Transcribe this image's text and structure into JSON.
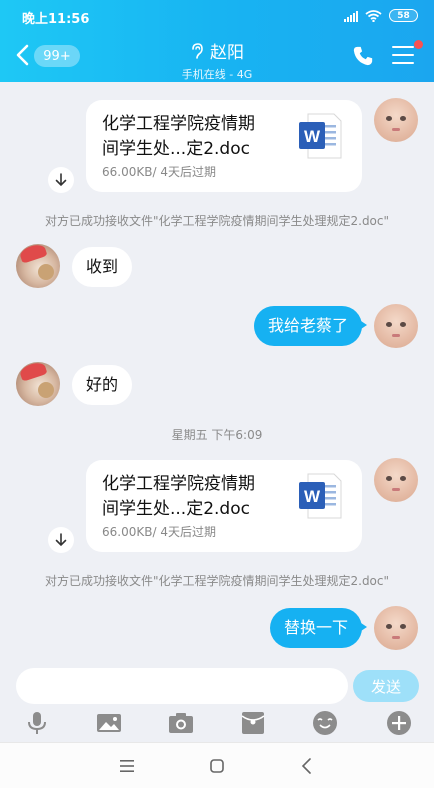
{
  "status_bar": {
    "time": "晚上11:56",
    "battery": "58"
  },
  "header": {
    "unread_badge": "99+",
    "contact_name": "赵阳",
    "contact_status": "手机在线 - 4G"
  },
  "messages": {
    "file1": {
      "name": "化学工程学院疫情期间学生处...定2.doc",
      "name_line1": "化学工程学院疫情期",
      "name_line2": "间学生处...定2.doc",
      "size": "66.00KB/",
      "expiry": "4天后过期"
    },
    "system1": "对方已成功接收文件\"化学工程学院疫情期间学生处理规定2.doc\"",
    "received1": "收到",
    "sent1": "我给老蔡了",
    "received2": "好的",
    "timestamp": "星期五 下午6:09",
    "file2": {
      "name": "化学工程学院疫情期间学生处...定2.doc",
      "name_line1": "化学工程学院疫情期",
      "name_line2": "间学生处...定2.doc",
      "size": "66.00KB/",
      "expiry": "4天后过期"
    },
    "system2": "对方已成功接收文件\"化学工程学院疫情期间学生处理规定2.doc\"",
    "sent2": "替换一下"
  },
  "input": {
    "placeholder": "",
    "send_label": "发送"
  },
  "colors": {
    "header": "#18b4f2",
    "sent_bubble": "#16b1f2",
    "send_disabled": "#9ee0f9",
    "badge_dot": "#fa5151"
  },
  "icons": {
    "toolbar": [
      "microphone-icon",
      "image-icon",
      "camera-icon",
      "red-packet-icon",
      "emoji-icon",
      "plus-icon"
    ],
    "system_nav": [
      "menu-icon",
      "home-icon",
      "back-icon"
    ]
  }
}
